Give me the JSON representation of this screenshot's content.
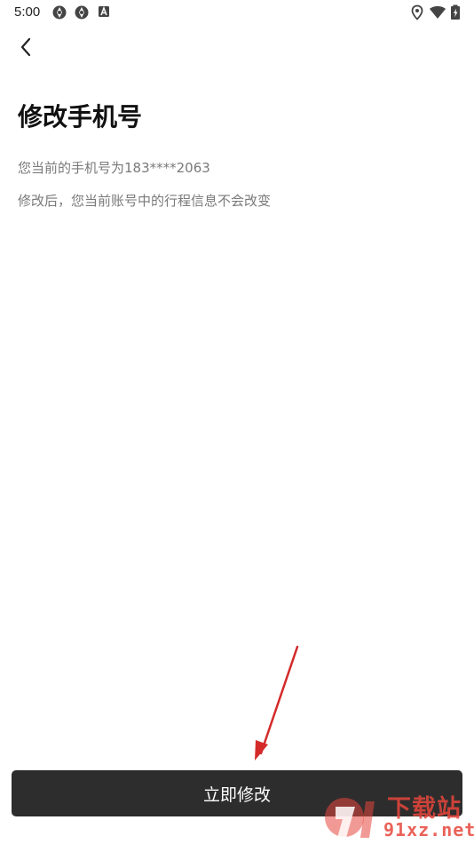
{
  "status_bar": {
    "time": "5:00",
    "left_icons": [
      "vpn-icon",
      "vpn-icon",
      "app-notification-icon"
    ],
    "right_icons": [
      "location-icon",
      "wifi-icon",
      "battery-icon"
    ]
  },
  "header": {
    "back_icon": "chevron-left-icon"
  },
  "main": {
    "title": "修改手机号",
    "current_phone_text": "您当前的手机号为183****2063",
    "notice_text": "修改后，您当前账号中的行程信息不会改变"
  },
  "footer": {
    "button_label": "立即修改"
  },
  "overlay": {
    "watermark_top": "下载站",
    "watermark_bottom": "91xz.net"
  },
  "colors": {
    "button_bg": "#2d2d2d",
    "button_text": "#ffffff",
    "secondary_text": "#7a7a7a",
    "arrow": "#d42a2a"
  }
}
